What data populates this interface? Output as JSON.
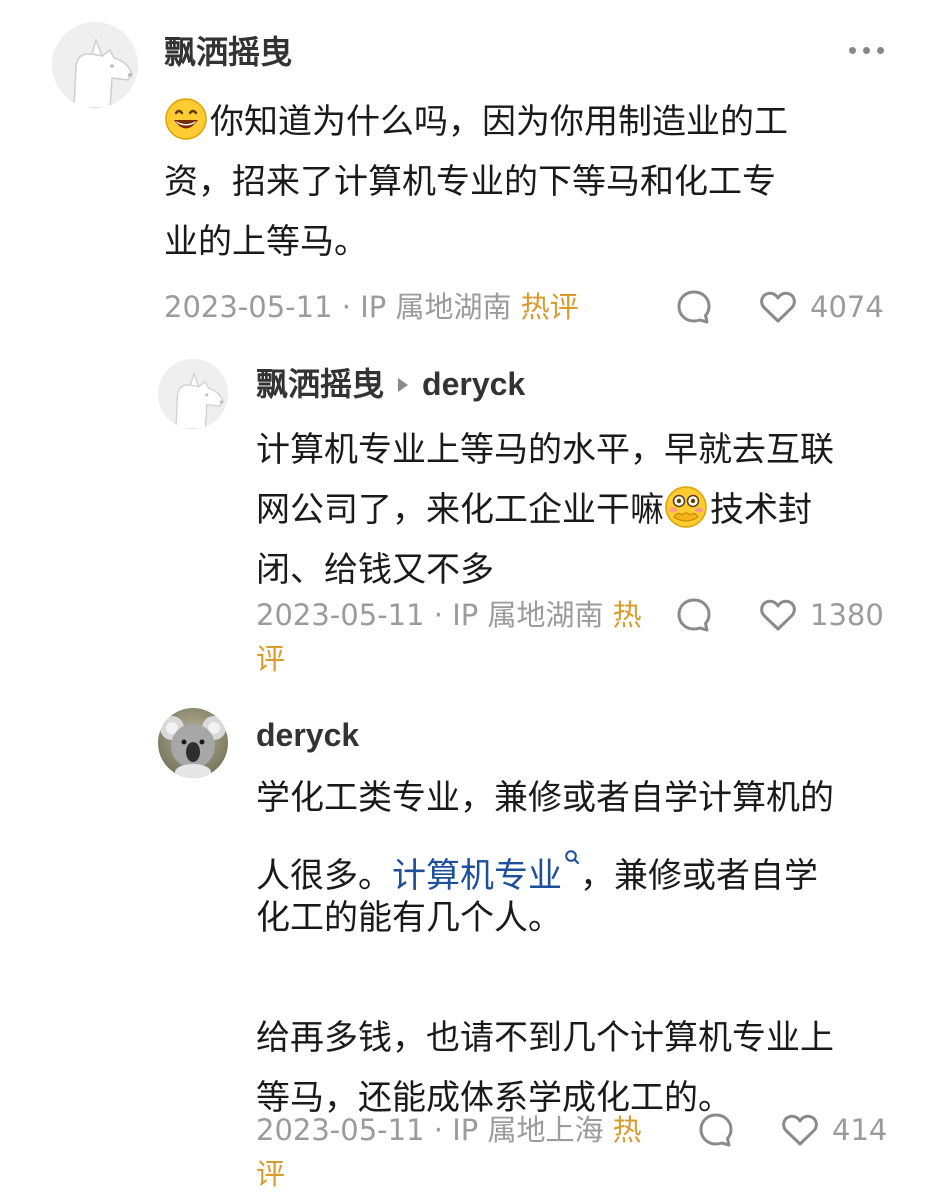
{
  "comments": [
    {
      "username": "飘洒摇曳",
      "emoji": "grinning-face-emoji",
      "lines": [
        "你知道为什么吗，因为你用制造业的工",
        "资，招来了计算机专业的下等马和化工专",
        "业的上等马。"
      ],
      "meta": "2023-05-11 · IP 属地湖南",
      "hot_label": "热评",
      "likes": "4074"
    },
    {
      "username": "飘洒摇曳",
      "reply_to": "deryck",
      "lines": [
        "计算机专业上等马的水平，早就去互联",
        "网公司了，来化工企业干嘛",
        "技术封",
        "闭、给钱又不多"
      ],
      "emoji": "hand-over-mouth-emoji",
      "meta": "2023-05-11 · IP 属地湖南",
      "hot_label_1": "热",
      "hot_label_2": "评",
      "likes": "1380"
    },
    {
      "username": "deryck",
      "lines": [
        "学化工类专业，兼修或者自学计算机的",
        "人很多。",
        "计算机专业",
        "，兼修或者自学",
        "化工的能有几个人。",
        "",
        "给再多钱，也请不到几个计算机专业上",
        "等马，还能成体系学成化工的。"
      ],
      "meta": "2023-05-11 · IP 属地上海",
      "hot_label_1": "热",
      "hot_label_2": "评",
      "likes": "414"
    }
  ],
  "colors": {
    "hot": "#d99b2b",
    "link": "#1d4f9a",
    "meta": "#9b9b9b"
  }
}
